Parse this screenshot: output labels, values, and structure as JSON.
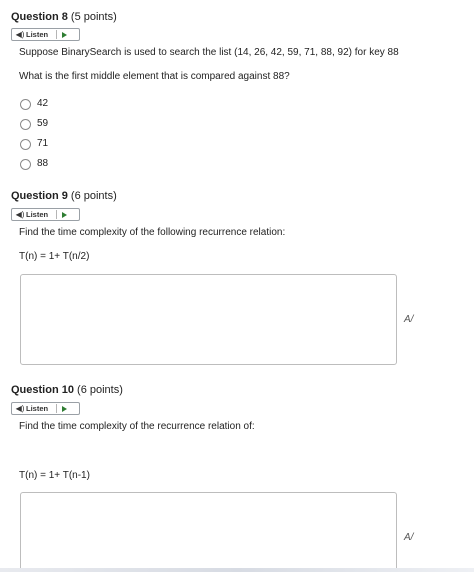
{
  "questions": [
    {
      "title": "Question 8",
      "points": "(5 points)",
      "listen_label": "Listen",
      "prompt": "Suppose BinarySearch is used to search the list (14, 26, 42, 59, 71, 88, 92) for key 88",
      "subprompt": "What is the first middle element that is compared against 88?",
      "options": [
        "42",
        "59",
        "71",
        "88"
      ]
    },
    {
      "title": "Question 9",
      "points": "(6 points)",
      "listen_label": "Listen",
      "prompt": "Find the time complexity of the following recurrence relation:",
      "formula": "T(n) = 1+ T(n/2)",
      "answer_value": ""
    },
    {
      "title": "Question 10",
      "points": "(6 points)",
      "listen_label": "Listen",
      "prompt": "Find the time complexity of the recurrence relation of:",
      "formula": "T(n) = 1+ T(n-1)",
      "answer_value": ""
    }
  ],
  "icons": {
    "speaker": "speaker-icon",
    "play": "play-icon",
    "spellcheck": "spellcheck-icon"
  },
  "spellcheck_glyph": "A/",
  "colors": {
    "play": "#2e7d32"
  }
}
